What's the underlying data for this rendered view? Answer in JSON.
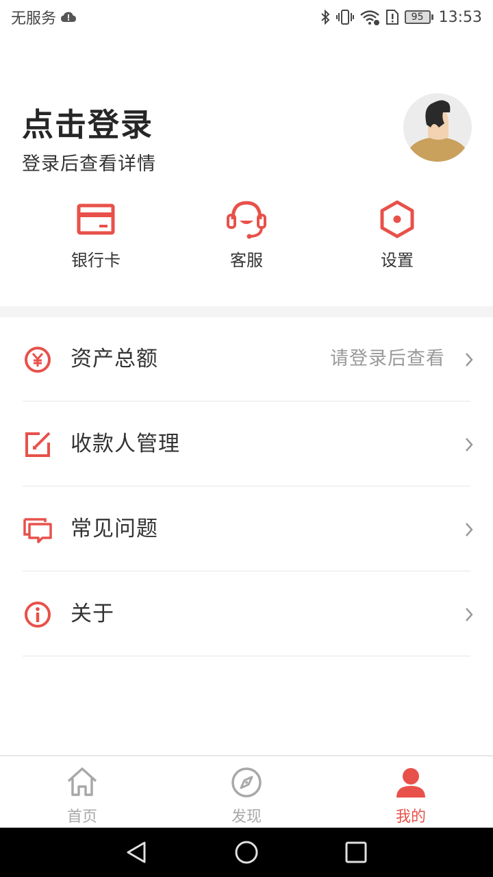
{
  "status_bar": {
    "carrier": "无服务",
    "battery": "95",
    "time": "13:53"
  },
  "header": {
    "title": "点击登录",
    "subtitle": "登录后查看详情"
  },
  "quick_actions": [
    {
      "label": "银行卡",
      "icon": "bank-card-icon"
    },
    {
      "label": "客服",
      "icon": "headset-icon"
    },
    {
      "label": "设置",
      "icon": "settings-hexagon-icon"
    }
  ],
  "menu": [
    {
      "label": "资产总额",
      "hint": "请登录后查看",
      "icon": "yuan-circle-icon"
    },
    {
      "label": "收款人管理",
      "hint": "",
      "icon": "edit-square-icon"
    },
    {
      "label": "常见问题",
      "hint": "",
      "icon": "chat-bubbles-icon"
    },
    {
      "label": "关于",
      "hint": "",
      "icon": "info-circle-icon"
    }
  ],
  "bottom_nav": [
    {
      "label": "首页",
      "icon": "home-icon",
      "active": false
    },
    {
      "label": "发现",
      "icon": "compass-icon",
      "active": false
    },
    {
      "label": "我的",
      "icon": "person-icon",
      "active": true
    }
  ],
  "colors": {
    "accent": "#e8514a",
    "text_primary": "#333333",
    "text_hint": "#999999",
    "nav_inactive": "#a8a8a8"
  }
}
